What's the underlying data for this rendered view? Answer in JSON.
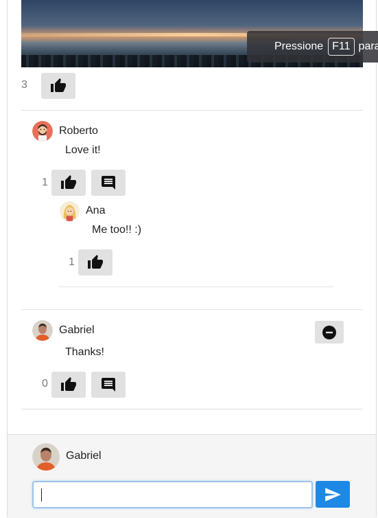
{
  "post": {
    "image_icon": "sunset-sea-photo",
    "like_count": "3"
  },
  "fullscreen_notice": {
    "prefix": "Pressione",
    "key": "F11",
    "suffix": "para"
  },
  "comments": [
    {
      "author": "Roberto",
      "avatar_icon": "bearded-man-avatar",
      "text": "Love it!",
      "like_count": "1",
      "replies": [
        {
          "author": "Ana",
          "avatar_icon": "blonde-woman-avatar",
          "text": "Me too!! :)",
          "like_count": "1"
        }
      ]
    },
    {
      "author": "Gabriel",
      "avatar_icon": "user-photo-avatar",
      "text": "Thanks!",
      "like_count": "0",
      "delete_icon": "minus-circle-icon"
    }
  ],
  "composer": {
    "user_name": "Gabriel",
    "input_value": "",
    "input_placeholder": "",
    "send_icon": "send-icon"
  },
  "icons": {
    "like": "thumbs-up-icon",
    "reply": "comment-icon"
  },
  "colors": {
    "accent": "#1e88e5",
    "button_bg": "#e1e1e1",
    "footer_bg": "#f5f5f5"
  }
}
